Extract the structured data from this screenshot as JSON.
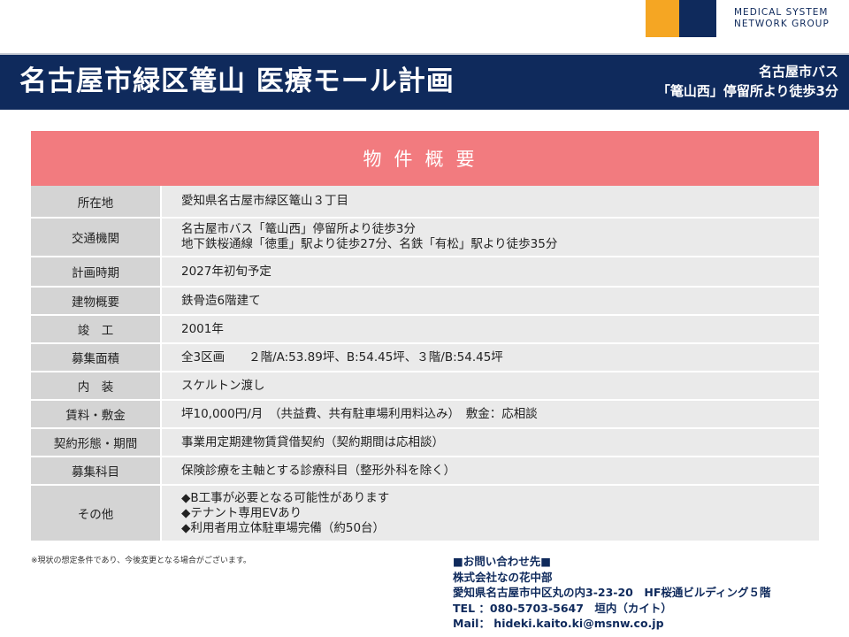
{
  "logo": {
    "line1": "MEDICAL SYSTEM",
    "line2": "NETWORK GROUP",
    "orange": "#f5a623",
    "navy": "#0f2a5c"
  },
  "header": {
    "title": "名古屋市緑区篭山 医療モール計画",
    "sub_line1": "名古屋市バス",
    "sub_line2": "「篭山西」停留所より徒歩3分"
  },
  "table": {
    "heading": "物件概要",
    "rows": [
      {
        "label": "所在地",
        "values": [
          "愛知県名古屋市緑区篭山３丁目"
        ]
      },
      {
        "label": "交通機関",
        "values": [
          "名古屋市バス「篭山西」停留所より徒歩3分",
          "地下鉄桜通線「徳重」駅より徒歩27分、名鉄「有松」駅より徒歩35分"
        ]
      },
      {
        "label": "計画時期",
        "values": [
          "2027年初旬予定"
        ]
      },
      {
        "label": "建物概要",
        "values": [
          "鉄骨造6階建て"
        ]
      },
      {
        "label": "竣　工",
        "values": [
          "2001年"
        ]
      },
      {
        "label": "募集面積",
        "values": [
          "全3区画　　２階/A:53.89坪、B:54.45坪、３階/B:54.45坪"
        ]
      },
      {
        "label": "内　装",
        "values": [
          "スケルトン渡し"
        ]
      },
      {
        "label": "賃料・敷金",
        "values": [
          "坪10,000円/月　（共益費、共有駐車場利用料込み）　敷金：応相談"
        ]
      },
      {
        "label": "契約形態・期間",
        "values": [
          "事業用定期建物賃貸借契約（契約期間は応相談）"
        ]
      },
      {
        "label": "募集科目",
        "values": [
          "保険診療を主軸とする診療科目（整形外科を除く）"
        ]
      },
      {
        "label": "その他",
        "values": [
          "◆B工事が必要となる可能性があります",
          "◆テナント専用EVあり",
          "◆利用者用立体駐車場完備（約50台）"
        ]
      }
    ]
  },
  "footer": {
    "note": "※現状の想定条件であり、今後変更となる場合がございます。",
    "contact": {
      "heading": "■お問い合わせ先■",
      "company": "株式会社なの花中部",
      "address": "愛知県名古屋市中区丸の内3-23-20　HF桜通ビルディング５階",
      "tel": "TEL ：080-5703-5647　垣内（カイト）",
      "mail": "Mail： hideki.kaito.ki@msnw.co.jp"
    }
  },
  "colors": {
    "accent": "#f27b7f",
    "header_bg": "#0f2a5c",
    "label_bg": "#d4d4d4",
    "value_bg": "#eaeaea"
  }
}
